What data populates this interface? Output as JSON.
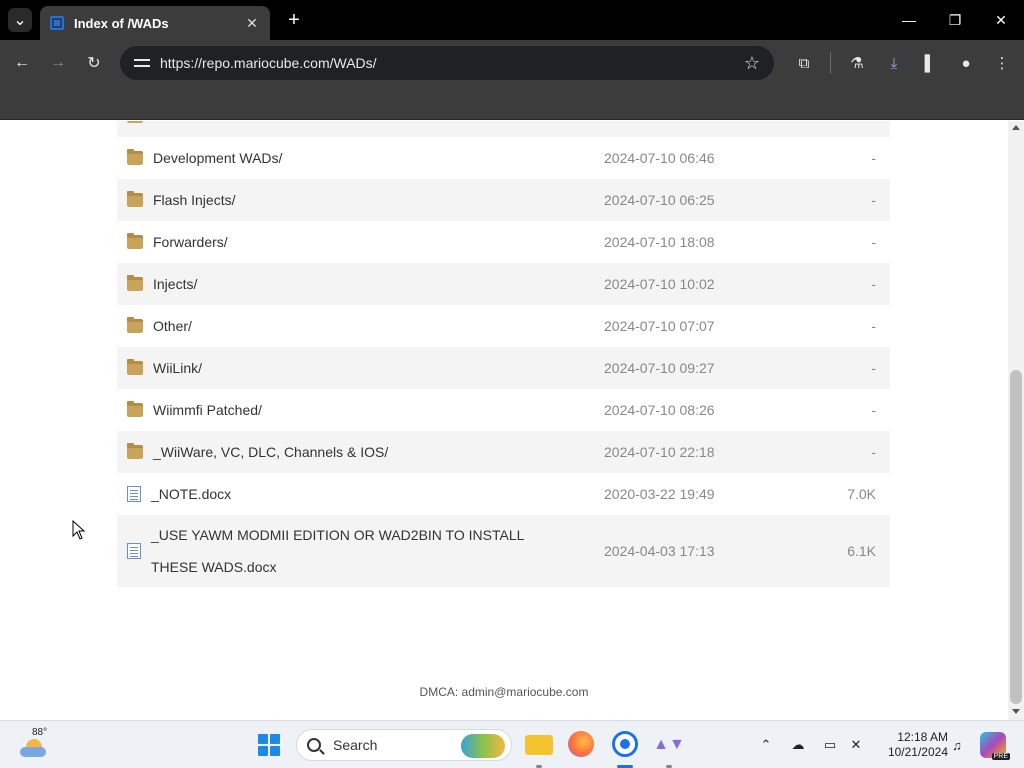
{
  "browser": {
    "tab_title": "Index of /WADs",
    "url": "https://repo.mariocube.com/WADs/",
    "tab_close": "✕",
    "new_tab": "+",
    "win_min": "—",
    "win_max": "❐",
    "win_close": "✕"
  },
  "listing": {
    "rows": [
      {
        "name": "",
        "date": "",
        "size": "",
        "type": "folder"
      },
      {
        "name": "Development WADs/",
        "date": "2024-07-10 06:46",
        "size": "-",
        "type": "folder"
      },
      {
        "name": "Flash Injects/",
        "date": "2024-07-10 06:25",
        "size": "-",
        "type": "folder"
      },
      {
        "name": "Forwarders/",
        "date": "2024-07-10 18:08",
        "size": "-",
        "type": "folder"
      },
      {
        "name": "Injects/",
        "date": "2024-07-10 10:02",
        "size": "-",
        "type": "folder"
      },
      {
        "name": "Other/",
        "date": "2024-07-10 07:07",
        "size": "-",
        "type": "folder"
      },
      {
        "name": "WiiLink/",
        "date": "2024-07-10 09:27",
        "size": "-",
        "type": "folder"
      },
      {
        "name": "Wiimmfi Patched/",
        "date": "2024-07-10 08:26",
        "size": "-",
        "type": "folder"
      },
      {
        "name": "_WiiWare, VC, DLC, Channels & IOS/",
        "date": "2024-07-10 22:18",
        "size": "-",
        "type": "folder"
      },
      {
        "name": "_NOTE.docx",
        "date": "2020-03-22 19:49",
        "size": "7.0K",
        "type": "doc"
      },
      {
        "name": "_USE YAWM MODMII EDITION OR WAD2BIN TO INSTALL THESE WADS.docx",
        "date": "2024-04-03 17:13",
        "size": "6.1K",
        "type": "doc"
      }
    ]
  },
  "footer": {
    "text": "DMCA: admin@mariocube.com"
  },
  "taskbar": {
    "weather_temp": "88°",
    "search_label": "Search",
    "time": "12:18 AM",
    "date": "10/21/2024",
    "copilot_badge": "PRE"
  },
  "colors": {
    "chrome_dark": "#3c3c3c",
    "folder": "#c8a35a",
    "row_alt": "#f4f4f4",
    "accent": "#1a73e8"
  }
}
